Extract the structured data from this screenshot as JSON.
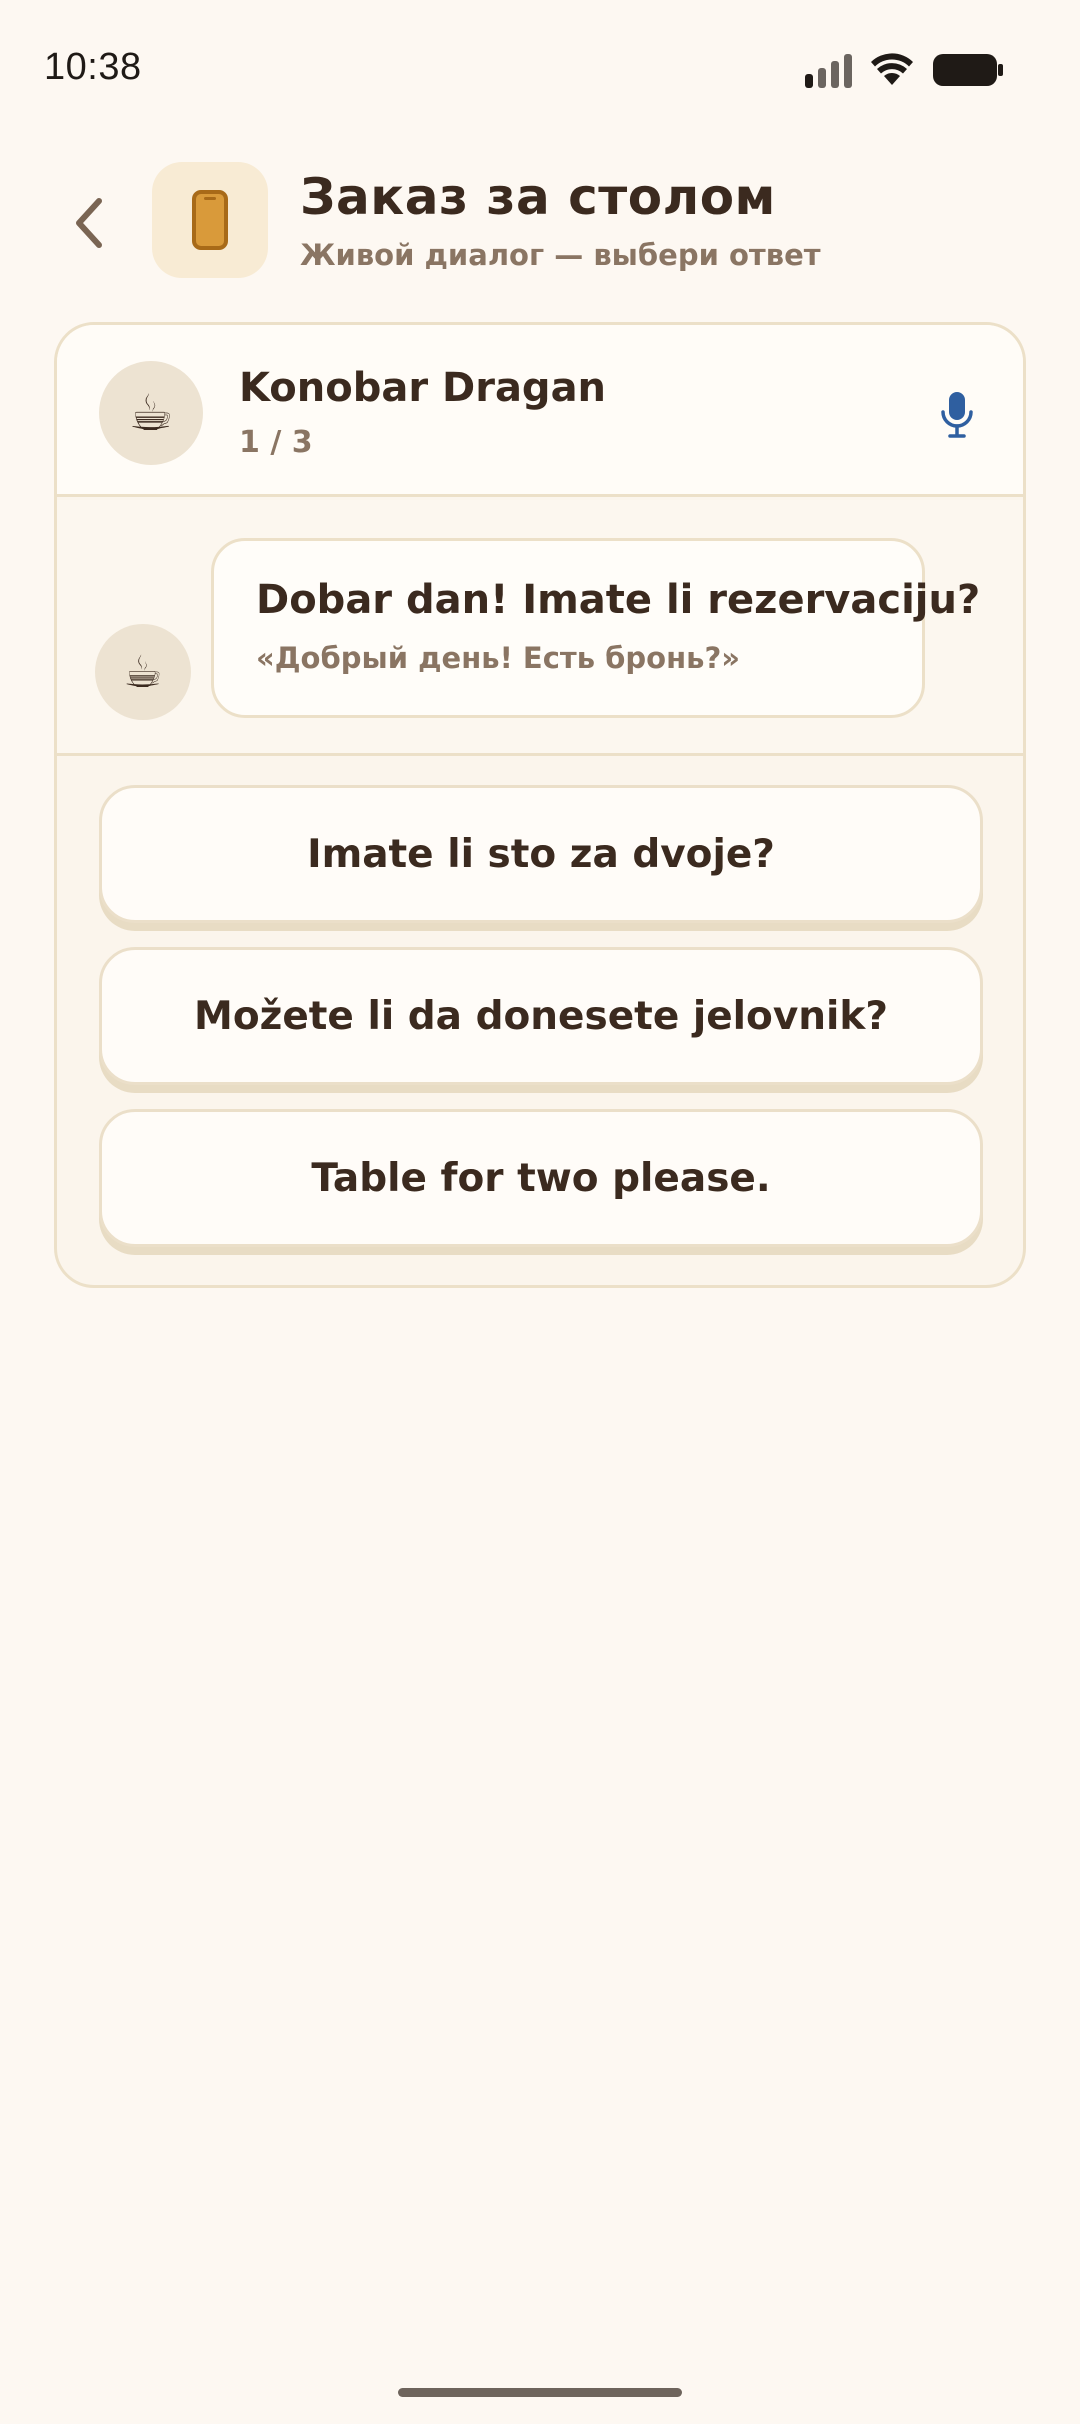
{
  "status_bar": {
    "time": "10:38"
  },
  "header": {
    "title": "Заказ за столом",
    "subtitle": "Живой диалог — выбери ответ",
    "icon": "phone-icon"
  },
  "dialog": {
    "speaker_name": "Konobar Dragan",
    "speaker_avatar": "☕",
    "progress": "1 / 3",
    "message": {
      "text": "Dobar dan! Imate li rezervaciju?",
      "translation": "«Добрый день! Есть бронь?»"
    },
    "options": [
      {
        "label": "Imate li sto za dvoje?"
      },
      {
        "label": "Možete li da donesete jelovnik?"
      },
      {
        "label": "Table for two please."
      }
    ]
  },
  "colors": {
    "background": "#fdf8f2",
    "accent_orange": "#c98a2b",
    "mic_blue": "#2f5fa0",
    "text_primary": "#3b2a1f",
    "text_secondary": "#8a7563",
    "border": "#ece0c8"
  }
}
